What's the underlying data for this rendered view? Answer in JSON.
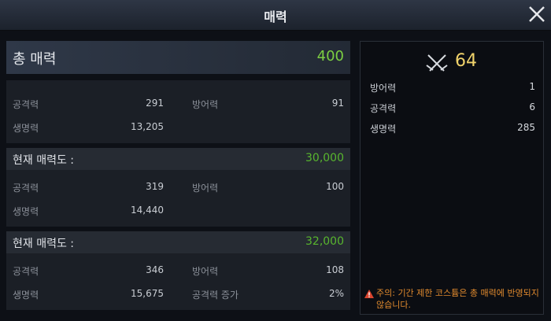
{
  "window": {
    "title": "매력",
    "close_icon": "close-icon"
  },
  "total": {
    "label": "총 매력",
    "value": "400",
    "value_color": "#7ccf42"
  },
  "base_stats": [
    {
      "label": "공격력",
      "value": "291"
    },
    {
      "label": "방어력",
      "value": "91"
    },
    {
      "label": "생명력",
      "value": "13,205"
    }
  ],
  "tiers": [
    {
      "label": "현재 매력도 :",
      "threshold": "30,000",
      "stats": [
        {
          "label": "공격력",
          "value": "319"
        },
        {
          "label": "방어력",
          "value": "100"
        },
        {
          "label": "생명력",
          "value": "14,440"
        }
      ]
    },
    {
      "label": "현재 매력도 :",
      "threshold": "32,000",
      "stats": [
        {
          "label": "공격력",
          "value": "346"
        },
        {
          "label": "방어력",
          "value": "108"
        },
        {
          "label": "생명력",
          "value": "15,675"
        },
        {
          "label": "공격력 증가",
          "value": "2%"
        }
      ]
    }
  ],
  "bonus": {
    "power_icon": "crossed-swords-icon",
    "power_value": "64",
    "stats": [
      {
        "label": "방어력",
        "value": "1"
      },
      {
        "label": "공격력",
        "value": "6"
      },
      {
        "label": "생명력",
        "value": "285"
      }
    ]
  },
  "notice": {
    "icon": "warning-icon",
    "text": "주의: 기간 제한 코스튬은 총 매력에 반영되지 않습니다."
  }
}
